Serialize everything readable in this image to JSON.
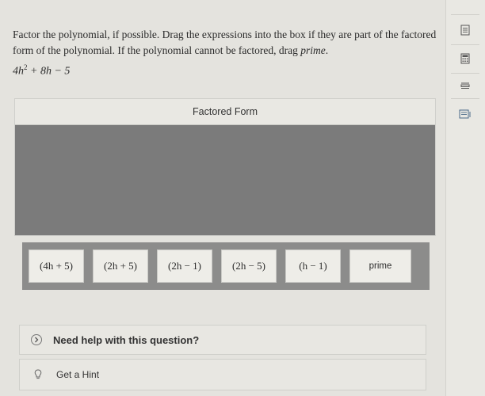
{
  "question": {
    "instruction_part1": "Factor the polynomial, if possible. Drag the expressions into the box if they are part of the factored form of the polynomial. If the polynomial cannot be factored, drag ",
    "instruction_italic": "prime",
    "instruction_end": ".",
    "polynomial": {
      "lead": "4h",
      "exponent": "2",
      "rest": " + 8h − 5"
    }
  },
  "factored_form": {
    "header": "Factored Form"
  },
  "tiles": [
    {
      "label": "(4h + 5)"
    },
    {
      "label": "(2h + 5)"
    },
    {
      "label": "(2h − 1)"
    },
    {
      "label": "(2h − 5)"
    },
    {
      "label": "(h − 1)"
    },
    {
      "label": "prime"
    }
  ],
  "help": {
    "label": "Need help with this question?"
  },
  "hint": {
    "label": "Get a Hint"
  },
  "rail": {
    "icons": [
      "notes-icon",
      "calculator-icon",
      "formula-icon",
      "reference-icon"
    ]
  },
  "colors": {
    "drop_area": "#7b7b7b",
    "tray": "#8c8c8b",
    "page": "#e4e3de"
  }
}
